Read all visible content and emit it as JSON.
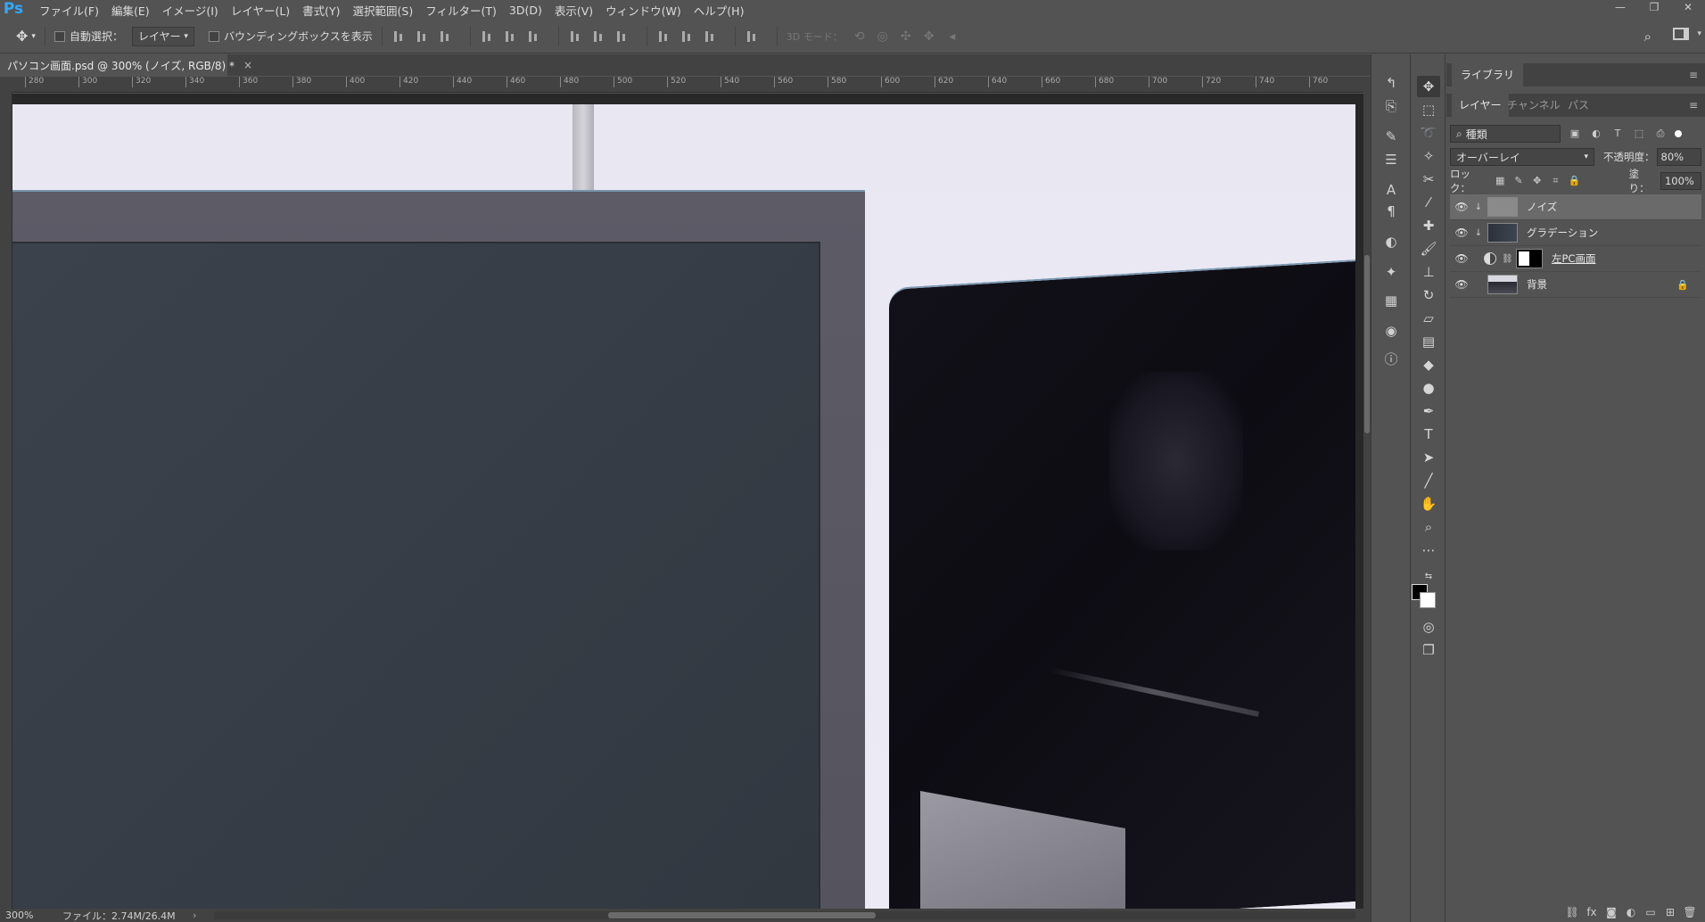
{
  "app": {
    "logo": "Ps",
    "menu": [
      "ファイル(F)",
      "編集(E)",
      "イメージ(I)",
      "レイヤー(L)",
      "書式(Y)",
      "選択範囲(S)",
      "フィルター(T)",
      "3D(D)",
      "表示(V)",
      "ウィンドウ(W)",
      "ヘルプ(H)"
    ],
    "window_controls": {
      "minimize": "—",
      "restore": "❐",
      "close": "✕"
    }
  },
  "options": {
    "auto_select_label": "自動選択：",
    "auto_select_target": "レイヤー",
    "show_transform_label": "バウンディングボックスを表示",
    "mode_3d_label": "3D モード："
  },
  "document": {
    "tab_title": "パソコン画面.psd @ 300% (ノイズ, RGB/8) *",
    "close_glyph": "×"
  },
  "ruler": {
    "h_ticks": [
      "280",
      "300",
      "320",
      "340",
      "360",
      "380",
      "400",
      "420",
      "440",
      "460",
      "480",
      "500",
      "520",
      "540",
      "560",
      "580",
      "600",
      "620",
      "640",
      "660",
      "680",
      "700",
      "720",
      "740",
      "760"
    ]
  },
  "status": {
    "zoom": "300%",
    "file_info": "ファイル：2.74M/26.4M",
    "arrow": "›"
  },
  "panels": {
    "library_tab": "ライブラリ",
    "tabs": [
      "レイヤー",
      "チャンネル",
      "パス"
    ],
    "filter_kind": "種類",
    "blend_mode": "オーバーレイ",
    "opacity_label": "不透明度：",
    "opacity_value": "80%",
    "lock_label": "ロック：",
    "fill_label": "塗り：",
    "fill_value": "100%",
    "layers": [
      {
        "name": "ノイズ",
        "selected": true
      },
      {
        "name": "グラデーション",
        "selected": false
      },
      {
        "name": "左PC画面",
        "selected": false
      },
      {
        "name": "背景",
        "selected": false
      }
    ]
  },
  "colors": {
    "ps_blue": "#31a8ff",
    "ui_bg": "#535353",
    "ui_dark": "#424242",
    "selected_layer": "#6a6a6a"
  }
}
